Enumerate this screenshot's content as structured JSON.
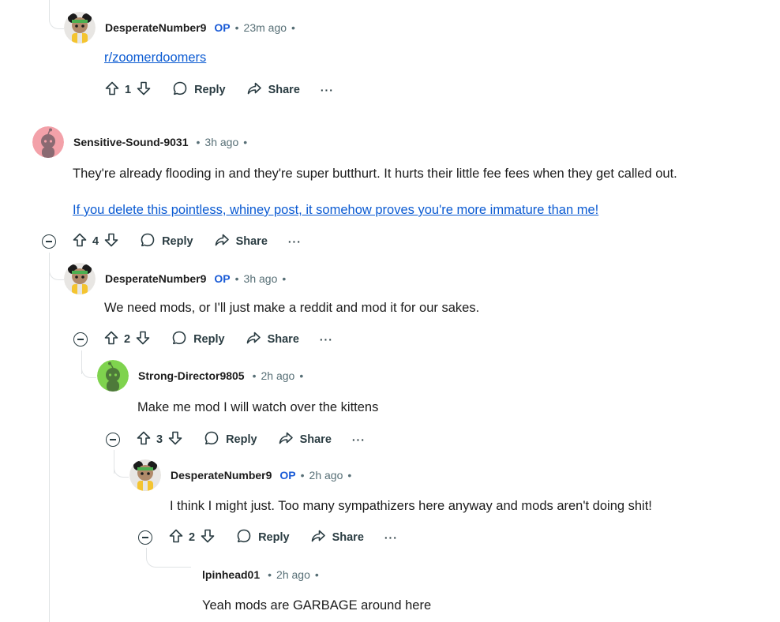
{
  "comments": [
    {
      "author": "DesperateNumber9",
      "op_badge": "OP",
      "time": "23m ago",
      "link": "r/zoomerdoomers",
      "score": "1",
      "reply_label": "Reply",
      "share_label": "Share",
      "more_label": "···"
    },
    {
      "author": "Sensitive-Sound-9031",
      "time": "3h ago",
      "text": "They're already flooding in and they're super butthurt. It hurts their little fee fees when they get called out.",
      "link": "If you delete this pointless, whiney post, it somehow proves you're more immature than me!",
      "score": "4",
      "reply_label": "Reply",
      "share_label": "Share",
      "more_label": "···"
    },
    {
      "author": "DesperateNumber9",
      "op_badge": "OP",
      "time": "3h ago",
      "text": "We need mods, or I'll just make a reddit and mod it for our sakes.",
      "score": "2",
      "reply_label": "Reply",
      "share_label": "Share",
      "more_label": "···"
    },
    {
      "author": "Strong-Director9805",
      "time": "2h ago",
      "text": "Make me mod I will watch over the kittens",
      "score": "3",
      "reply_label": "Reply",
      "share_label": "Share",
      "more_label": "···"
    },
    {
      "author": "DesperateNumber9",
      "op_badge": "OP",
      "time": "2h ago",
      "text": "I think I might just. Too many sympathizers here anyway and mods aren't doing shit!",
      "score": "2",
      "reply_label": "Reply",
      "share_label": "Share",
      "more_label": "···"
    },
    {
      "author": "lpinhead01",
      "time": "2h ago",
      "text": "Yeah mods are GARBAGE around here"
    }
  ],
  "separator": "•",
  "colors": {
    "op": "#1a5bd6",
    "link": "#0a5ad2",
    "thread_line": "#e0e3e5",
    "avatar_pink": "#f3a1a9",
    "avatar_green": "#7fd34e"
  },
  "icons": [
    "upvote-icon",
    "downvote-icon",
    "reply-icon",
    "share-icon",
    "collapse-icon",
    "more-icon"
  ]
}
